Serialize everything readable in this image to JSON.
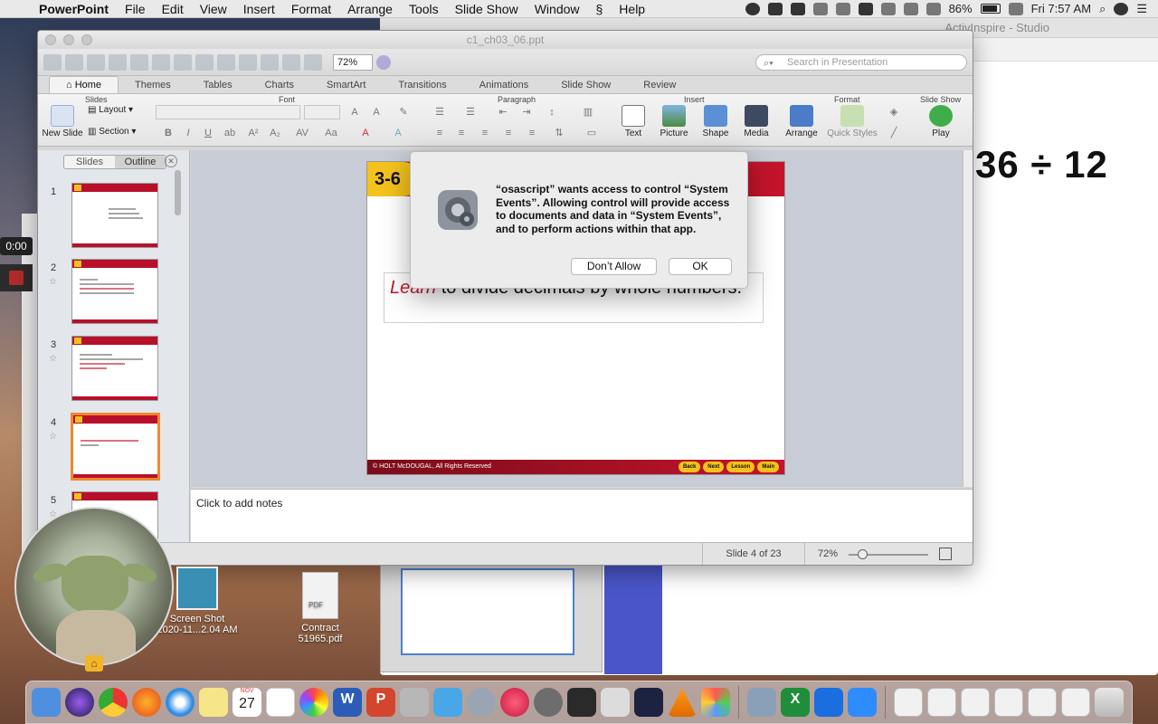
{
  "menubar": {
    "app_name": "PowerPoint",
    "items": [
      "File",
      "Edit",
      "View",
      "Insert",
      "Format",
      "Arrange",
      "Tools",
      "Slide Show",
      "Window",
      "Help"
    ],
    "battery": "86%",
    "clock": "Fri 7:57 AM"
  },
  "studio": {
    "title": "ActivInspire - Studio",
    "math": "36 ÷ 12"
  },
  "recorder": {
    "timer": "0:00"
  },
  "ppt": {
    "file_title": "c1_ch03_06.ppt",
    "zoom_box": "72%",
    "search_placeholder": "Search in Presentation",
    "tabs": [
      "Home",
      "Themes",
      "Tables",
      "Charts",
      "SmartArt",
      "Transitions",
      "Animations",
      "Slide Show",
      "Review"
    ],
    "groups": {
      "slides": "Slides",
      "font": "Font",
      "paragraph": "Paragraph",
      "insert": "Insert",
      "format": "Format",
      "slideshow": "Slide Show"
    },
    "buttons": {
      "new_slide": "New Slide",
      "layout": "Layout",
      "section": "Section",
      "text": "Text",
      "picture": "Picture",
      "shape": "Shape",
      "media": "Media",
      "arrange": "Arrange",
      "quick_styles": "Quick Styles",
      "play": "Play"
    },
    "sidebar_tabs": {
      "slides": "Slides",
      "outline": "Outline"
    },
    "thumbnails": [
      "1",
      "2",
      "3",
      "4",
      "5"
    ],
    "slide": {
      "badge": "3-6",
      "objective_learn": "Learn",
      "objective_rest": " to divide decimals by whole numbers.",
      "footer": "© HOLT McDOUGAL, All Rights Reserved",
      "nav": [
        "Back",
        "Next",
        "Lesson",
        "Main"
      ]
    },
    "notes_placeholder": "Click to add notes",
    "status_slide": "Slide 4 of 23",
    "status_zoom": "72%"
  },
  "dialog": {
    "message": "“osascript” wants access to control “System Events”. Allowing control will provide access to documents and data in “System Events”, and to perform actions within that app.",
    "deny_label": "Don’t Allow",
    "ok_label": "OK"
  },
  "desktop": {
    "icons": [
      {
        "label_line1": "Screen Shot",
        "label_line2": "2020-11...2.04 AM"
      },
      {
        "label_line1": "Contract",
        "label_line2": "51965.pdf"
      }
    ],
    "pdf_tag": "PDF"
  },
  "dock": {
    "calendar_day": "27",
    "calendar_month": "NOV"
  }
}
